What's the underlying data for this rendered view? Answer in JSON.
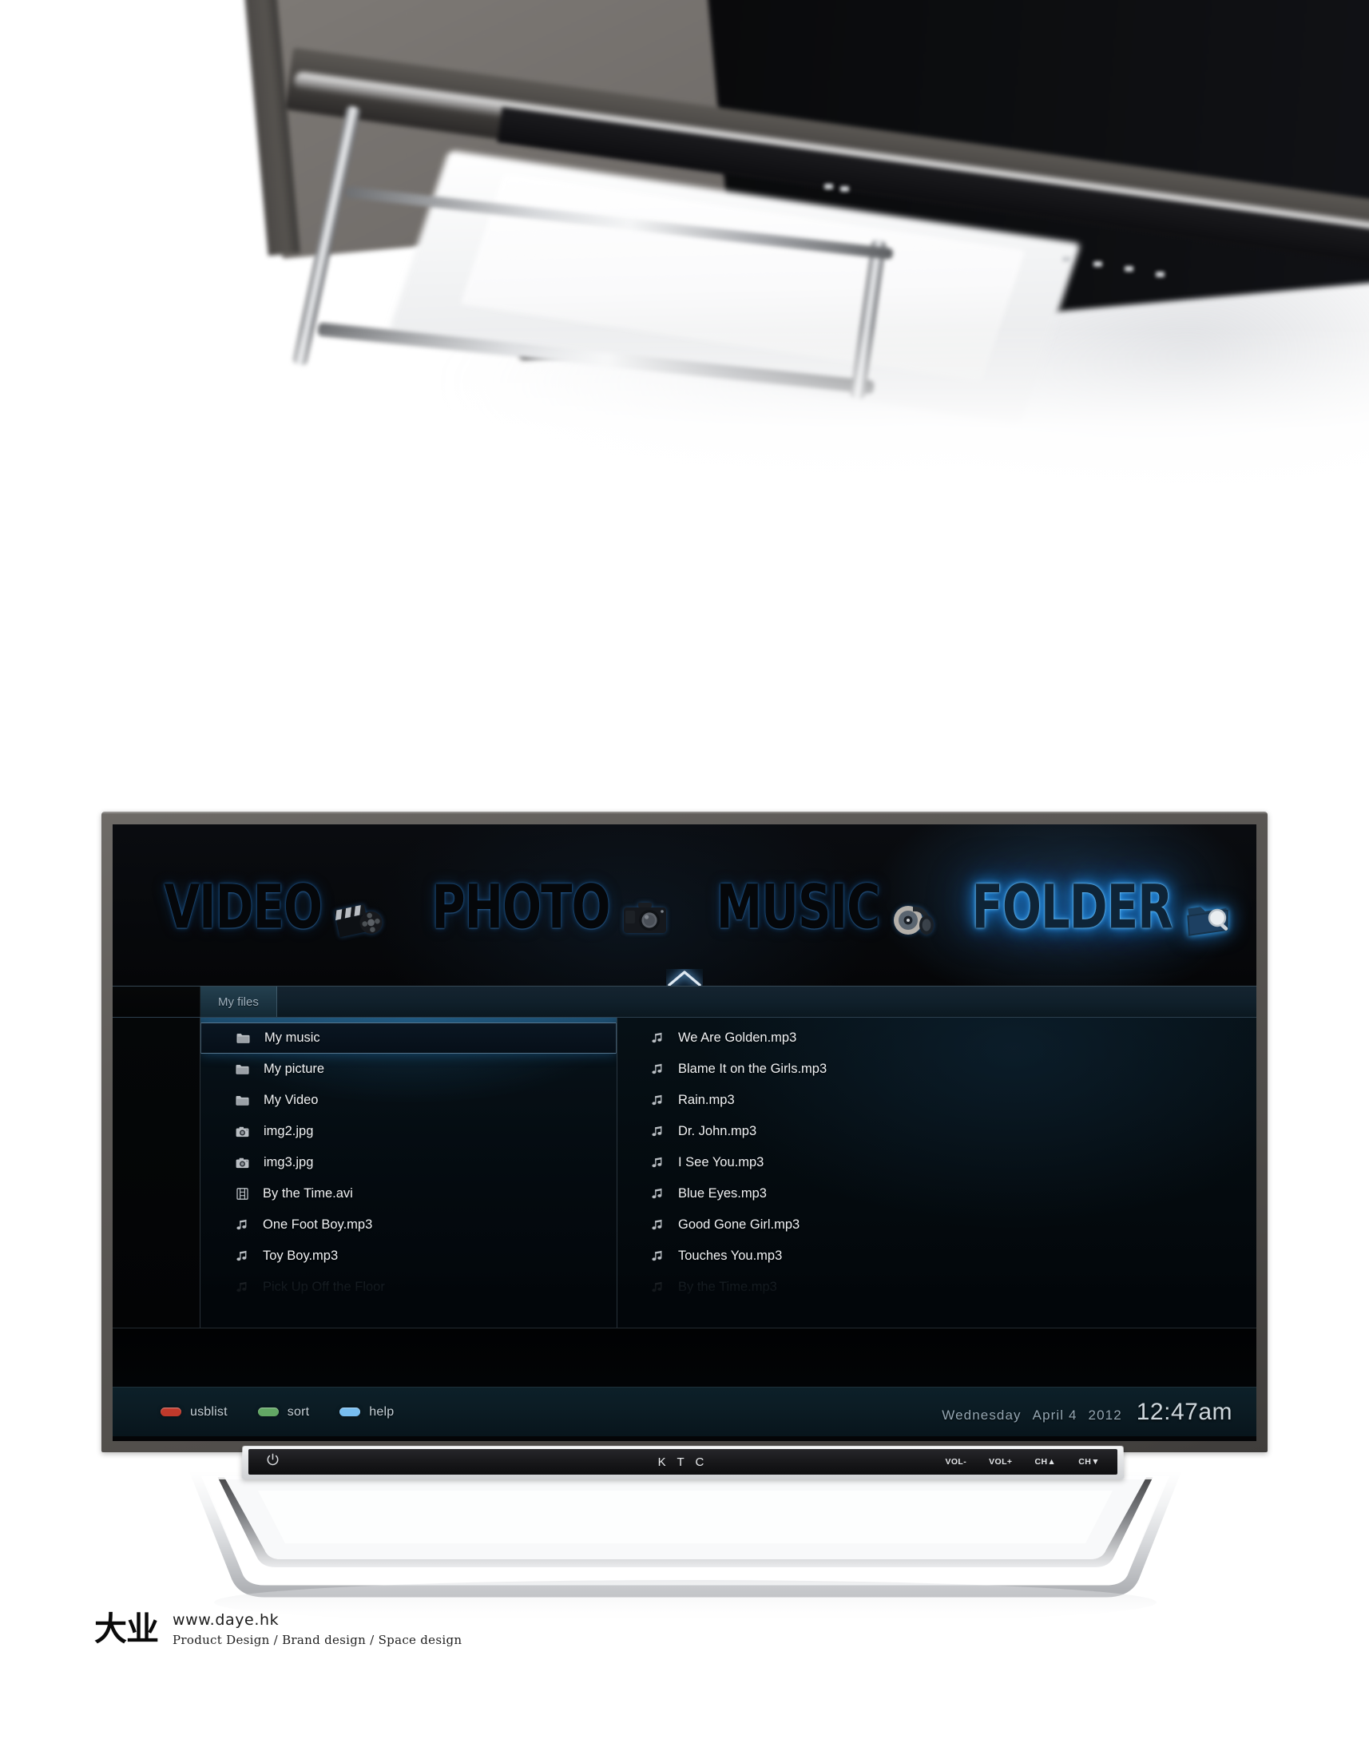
{
  "hero": {
    "description": "blurred-product-photo-tv-on-chrome-stand"
  },
  "tv": {
    "brand": "K T C",
    "controls": [
      {
        "name": "vol-down",
        "label": "VOL-"
      },
      {
        "name": "vol-up",
        "label": "VOL+"
      },
      {
        "name": "ch-up",
        "label": "CH▲"
      },
      {
        "name": "ch-down",
        "label": "CH▼"
      }
    ],
    "power_icon": "power-icon"
  },
  "menu": {
    "items": [
      {
        "label": "VIDEO",
        "icon": "clapperboard-icon",
        "active": false
      },
      {
        "label": "PHOTO",
        "icon": "camera-icon",
        "active": false
      },
      {
        "label": "MUSIC",
        "icon": "headphones-icon",
        "active": false
      },
      {
        "label": "FOLDER",
        "icon": "folder-search-icon",
        "active": true
      }
    ],
    "active_index": 3,
    "caret_icon": "chevron-up-icon"
  },
  "tabs": [
    {
      "label": "My files",
      "selected": true
    }
  ],
  "left_panel": {
    "items": [
      {
        "name": "My music",
        "icon": "folder-icon",
        "selected": true,
        "faded": false
      },
      {
        "name": "My picture",
        "icon": "folder-icon",
        "selected": false,
        "faded": false
      },
      {
        "name": "My Video",
        "icon": "folder-icon",
        "selected": false,
        "faded": false
      },
      {
        "name": "img2.jpg",
        "icon": "photo-icon",
        "selected": false,
        "faded": false
      },
      {
        "name": "img3.jpg",
        "icon": "photo-icon",
        "selected": false,
        "faded": false
      },
      {
        "name": "By the Time.avi",
        "icon": "film-icon",
        "selected": false,
        "faded": false
      },
      {
        "name": "One Foot Boy.mp3",
        "icon": "music-icon",
        "selected": false,
        "faded": false
      },
      {
        "name": "Toy Boy.mp3",
        "icon": "music-icon",
        "selected": false,
        "faded": false
      },
      {
        "name": "Pick Up Off the Floor",
        "icon": "music-icon",
        "selected": false,
        "faded": true
      }
    ]
  },
  "right_panel": {
    "items": [
      {
        "name": "We Are Golden.mp3",
        "icon": "music-icon",
        "faded": false
      },
      {
        "name": "Blame It on the Girls.mp3",
        "icon": "music-icon",
        "faded": false
      },
      {
        "name": "Rain.mp3",
        "icon": "music-icon",
        "faded": false
      },
      {
        "name": "Dr. John.mp3",
        "icon": "music-icon",
        "faded": false
      },
      {
        "name": "I See You.mp3",
        "icon": "music-icon",
        "faded": false
      },
      {
        "name": "Blue Eyes.mp3",
        "icon": "music-icon",
        "faded": false
      },
      {
        "name": "Good Gone Girl.mp3",
        "icon": "music-icon",
        "faded": false
      },
      {
        "name": "Touches You.mp3",
        "icon": "music-icon",
        "faded": false
      },
      {
        "name": "By the Time.mp3",
        "icon": "music-icon",
        "faded": true
      }
    ]
  },
  "statusbar": {
    "hotkeys": [
      {
        "label": "usblist",
        "color": "#c0392b"
      },
      {
        "label": "sort",
        "color": "#62a764"
      },
      {
        "label": "help",
        "color": "#77bdf0"
      }
    ],
    "weekday": "Wednesday",
    "date": "April 4",
    "year": "2012",
    "time": "12:47am"
  },
  "footer": {
    "logo": "大业",
    "url": "www.daye.hk",
    "services": "Product Design  /  Brand design  /  Space design"
  },
  "colors": {
    "accent_blue": "#2f95e0",
    "screen_bg": "#040507",
    "bezel": "#5d5a57"
  }
}
